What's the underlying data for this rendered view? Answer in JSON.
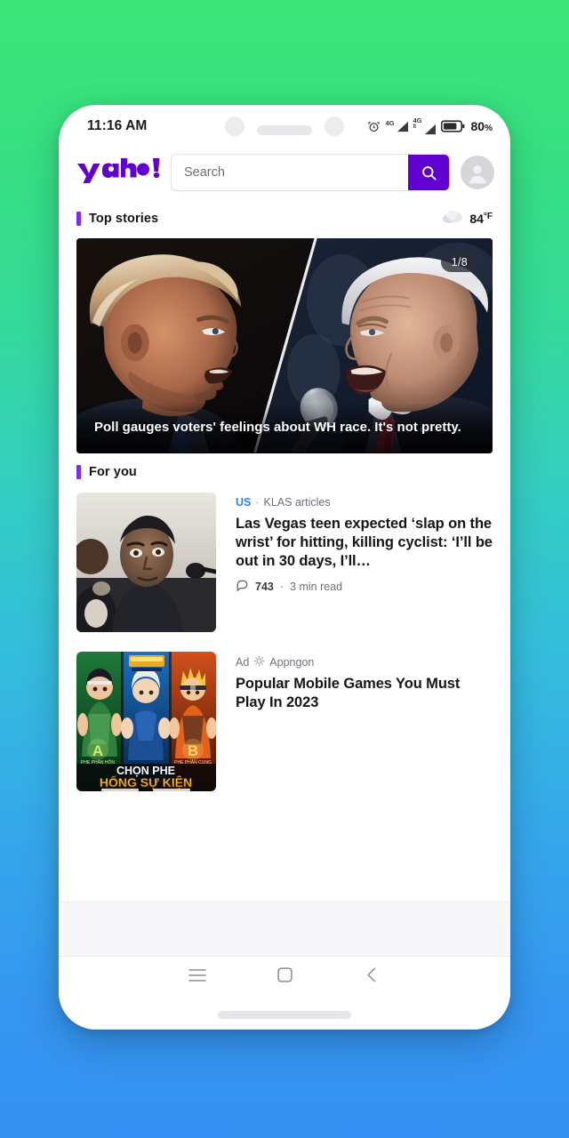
{
  "statusbar": {
    "time": "11:16 AM",
    "battery_percent": "80",
    "battery_unit": "%",
    "signal_label_1": "4G",
    "signal_label_2": "4G",
    "signal_sub_2": "lt",
    "icons": [
      "alarm-clock-icon",
      "signal-4g-icon",
      "signal-4g-icon",
      "battery-icon"
    ]
  },
  "header": {
    "logo_text": "yahoo!",
    "logo_color": "#6001d2",
    "search_placeholder": "Search",
    "search_value": "",
    "search_button_icon": "search-icon",
    "search_button_color": "#6001d2",
    "avatar_icon": "user-avatar-icon"
  },
  "top_stories": {
    "title": "Top stories",
    "accent_color": "#7a2ff0",
    "weather": {
      "icon": "cloud-icon",
      "temperature": "84",
      "unit": "°F"
    },
    "hero": {
      "counter": "1/8",
      "headline": "Poll gauges voters' feelings about WH race. It's not pretty.",
      "image_alt": "split-screen-trump-biden-debate"
    }
  },
  "for_you": {
    "title": "For you",
    "accent_color": "#7a2ff0",
    "articles": [
      {
        "source": "US",
        "source_color": "#2d7ff9",
        "publisher": "KLAS articles",
        "headline": "Las Vegas teen expected ‘slap on the wrist’ for hitting, killing cyclist: ‘I’ll be out in 30 days, I’ll…",
        "comment_icon": "comment-bubble-icon",
        "comment_count": "743",
        "read_time": "3 min read",
        "thumb_alt": "teen-in-dark-shirt-photo"
      },
      {
        "ad_label": "Ad",
        "ad_icon": "sponsor-badge-icon",
        "advertiser": "Appngon",
        "headline": "Popular Mobile Games You Must Play In 2023",
        "thumb_alt": "anime-mobile-game-banner",
        "thumb_text_line1": "CHỌN PHE",
        "thumb_text_line2": "HỐNG SỰ KIỆN",
        "thumb_badge_a": "A",
        "thumb_badge_b": "B"
      }
    ]
  },
  "navbar": {
    "recents_icon": "menu-recents-icon",
    "home_icon": "home-square-icon",
    "back_icon": "back-chevron-icon",
    "gesture_bar": "gesture-handle"
  }
}
